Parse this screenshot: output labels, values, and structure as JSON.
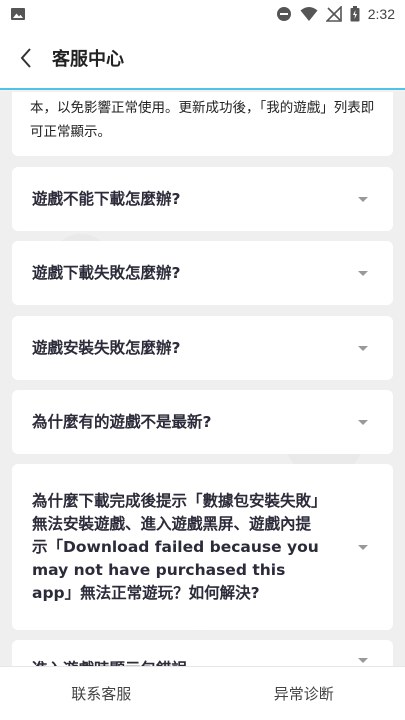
{
  "status_bar": {
    "time": "2:32",
    "icons": [
      "image-icon",
      "do-not-disturb-icon",
      "wifi-icon",
      "no-signal-icon",
      "battery-icon"
    ]
  },
  "app_bar": {
    "title": "客服中心",
    "back_icon": "chevron-left-icon",
    "accent_color": "#4fc3e6"
  },
  "intro_text": "本，以免影響正常使用。更新成功後，「我的遊戲」列表即可正常顯示。",
  "faqs": [
    {
      "question": "遊戲不能下載怎麼辦?"
    },
    {
      "question": "遊戲下載失敗怎麼辦?"
    },
    {
      "question": "遊戲安裝失敗怎麼辦?"
    },
    {
      "question": "為什麼有的遊戲不是最新?"
    },
    {
      "question": "為什麼下載完成後提示「數據包安裝失敗」無法安裝遊戲、進入遊戲黑屏、遊戲內提示「Download failed because you may not have purchased this app」無法正常遊玩？如何解決?"
    },
    {
      "question": "進入遊戲時顯示包錯誤"
    }
  ],
  "bottom_bar": {
    "contact_label": "联系客服",
    "diagnose_label": "异常诊断"
  }
}
